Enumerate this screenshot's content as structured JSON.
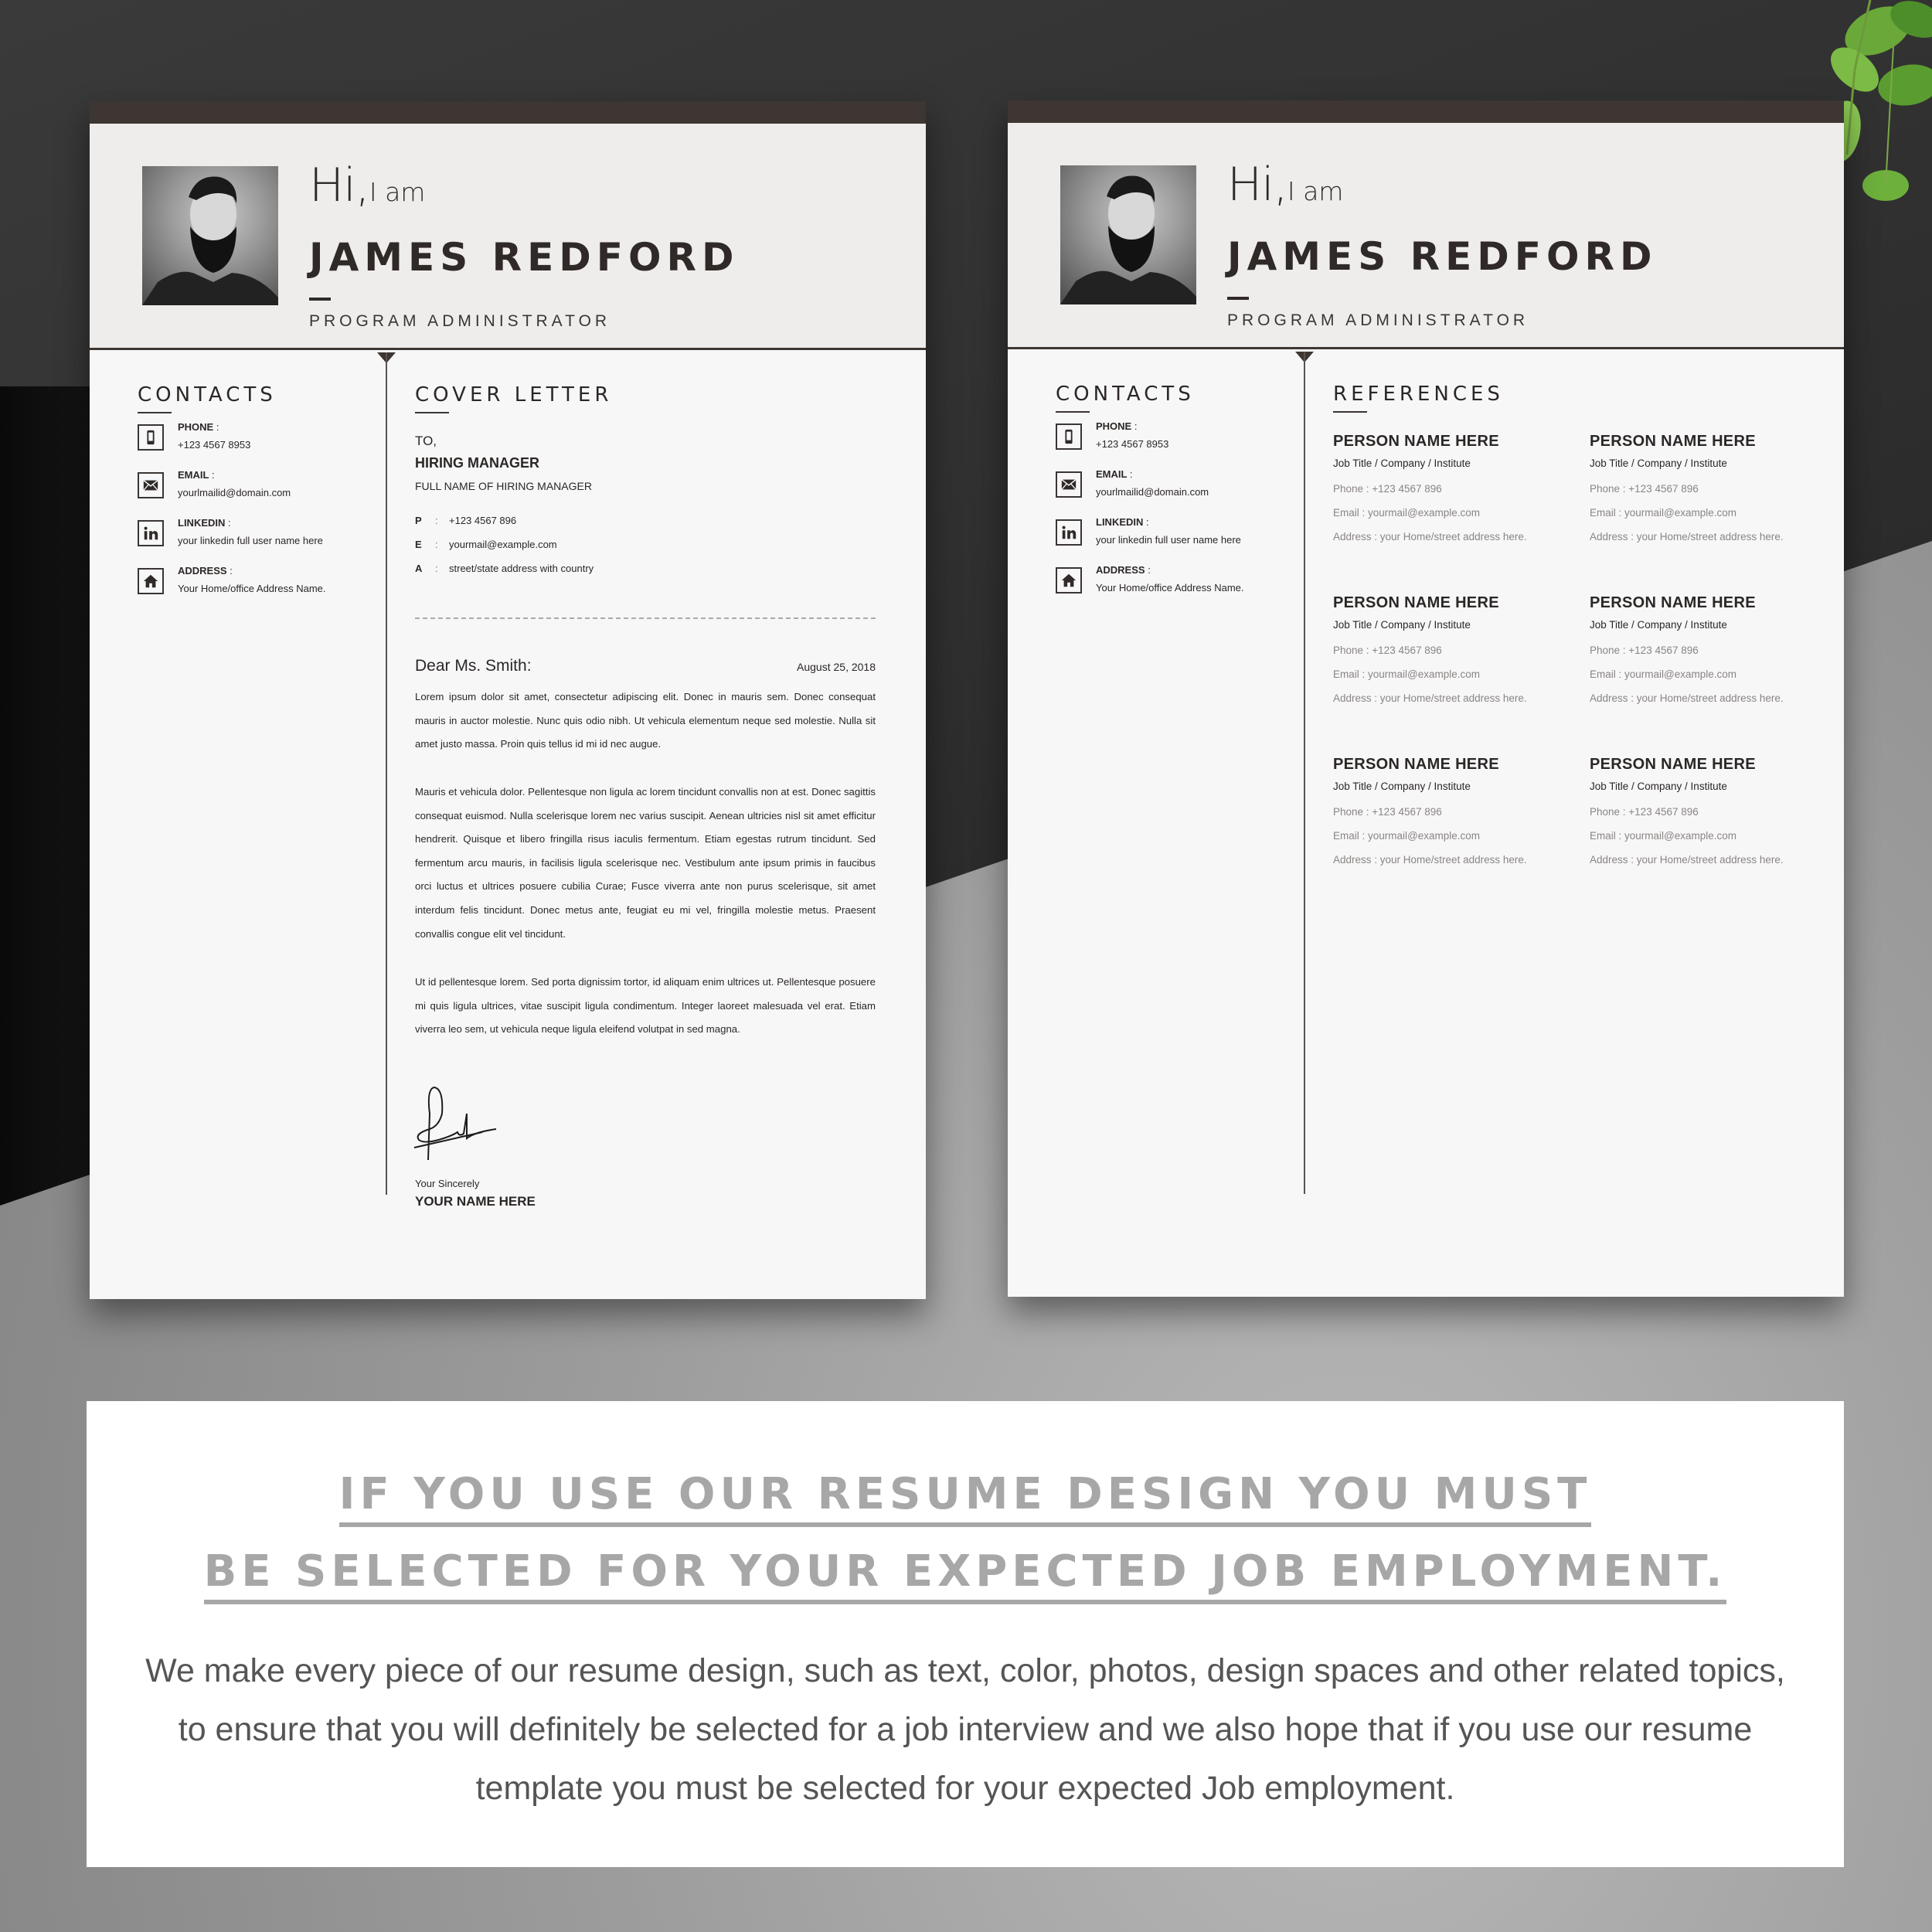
{
  "resume": {
    "greeting_big": "Hi,",
    "greeting_small": "I am",
    "name": "JAMES REDFORD",
    "role": "PROGRAM ADMINISTRATOR",
    "contacts_title": "CONTACTS",
    "contacts": [
      {
        "icon": "phone-icon",
        "label": "PHONE",
        "value": "+123 4567 8953"
      },
      {
        "icon": "email-icon",
        "label": "EMAIL",
        "value": "yourlmailid@domain.com"
      },
      {
        "icon": "linkedin-icon",
        "label": "LINKEDIN",
        "value": "your linkedin full user name here"
      },
      {
        "icon": "home-icon",
        "label": "ADDRESS",
        "value": "Your Home/office Address Name."
      }
    ],
    "colon": ":"
  },
  "cover_letter": {
    "title": "COVER LETTER",
    "to": "TO,",
    "recipient_title": "HIRING MANAGER",
    "recipient_name": "FULL NAME OF HIRING MANAGER",
    "details": [
      {
        "key": "P",
        "value": "+123 4567 896"
      },
      {
        "key": "E",
        "value": "yourmail@example.com"
      },
      {
        "key": "A",
        "value": "street/state address with country"
      }
    ],
    "salutation": "Dear Ms. Smith:",
    "date": "August 25, 2018",
    "paragraphs": [
      "Lorem ipsum dolor sit amet, consectetur adipiscing elit. Donec in mauris sem. Donec consequat mauris in auctor molestie. Nunc quis odio nibh. Ut vehicula elementum neque sed molestie. Nulla sit amet justo massa. Proin quis tellus id mi  id nec augue.",
      "Mauris et vehicula dolor. Pellentesque non ligula ac lorem tincidunt convallis non at est. Donec sagittis consequat euismod. Nulla scelerisque lorem nec varius suscipit. Aenean ultricies nisl sit amet efficitur hendrerit. Quisque et libero fringilla risus iaculis fermentum. Etiam egestas rutrum tincidunt. Sed fermentum arcu mauris, in facilisis ligula scelerisque nec. Vestibulum ante ipsum primis in faucibus orci luctus et ultrices posuere cubilia Curae; Fusce viverra ante non purus scelerisque, sit amet interdum felis tincidunt. Donec metus ante, feugiat eu mi vel, fringilla molestie metus. Praesent convallis congue elit vel tincidunt.",
      "Ut id pellentesque lorem. Sed porta dignissim tortor, id aliquam enim ultrices ut. Pellentesque posuere mi quis ligula ultrices, vitae suscipit ligula condimentum. Integer laoreet malesuada vel erat. Etiam viverra leo sem, ut vehicula neque ligula eleifend volutpat in sed magna."
    ],
    "closing": "Your Sincerely",
    "signer": "YOUR NAME HERE"
  },
  "references": {
    "title": "REFERENCES",
    "items": [
      {
        "name": "PERSON NAME HERE",
        "job": "Job Title / Company / Institute",
        "phone": "Phone  :  +123 4567 896",
        "email": "Email  :  yourmail@example.com",
        "address": "Address : your Home/street address here."
      },
      {
        "name": "PERSON NAME HERE",
        "job": "Job Title / Company / Institute",
        "phone": "Phone  :  +123 4567 896",
        "email": "Email  :  yourmail@example.com",
        "address": "Address : your Home/street address here."
      },
      {
        "name": "PERSON NAME HERE",
        "job": "Job Title / Company / Institute",
        "phone": "Phone  :  +123 4567 896",
        "email": "Email  :  yourmail@example.com",
        "address": "Address : your Home/street address here."
      },
      {
        "name": "PERSON NAME HERE",
        "job": "Job Title / Company / Institute",
        "phone": "Phone  :  +123 4567 896",
        "email": "Email  :  yourmail@example.com",
        "address": "Address : your Home/street address here."
      },
      {
        "name": "PERSON NAME HERE",
        "job": "Job Title / Company / Institute",
        "phone": "Phone  :  +123 4567 896",
        "email": "Email  :  yourmail@example.com",
        "address": "Address : your Home/street address here."
      },
      {
        "name": "PERSON NAME HERE",
        "job": "Job Title / Company / Institute",
        "phone": "Phone  :  +123 4567 896",
        "email": "Email  :  yourmail@example.com",
        "address": "Address : your Home/street address here."
      }
    ]
  },
  "banner": {
    "headline_line1": "IF YOU USE OUR RESUME DESIGN YOU MUST",
    "headline_line2": "BE SELECTED FOR YOUR EXPECTED JOB EMPLOYMENT.",
    "body": "We make every piece of our resume design, such as text, color, photos, design spaces and other related topics, to ensure that you will definitely be selected for a job interview and we also hope that if you use our resume template you must be selected for your expected Job employment."
  },
  "colors": {
    "header_bar": "#3d3632",
    "header_bg": "#efedec",
    "headline_gray": "#a7a7a7",
    "text_dark": "#2b2725"
  }
}
